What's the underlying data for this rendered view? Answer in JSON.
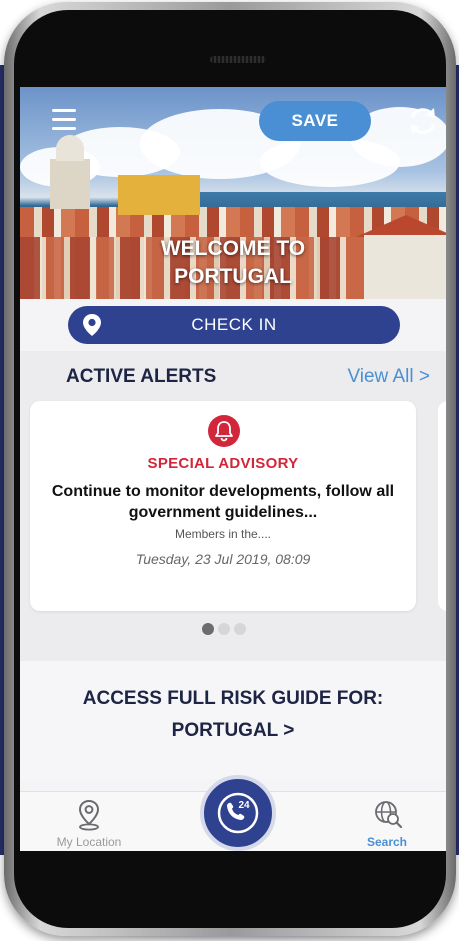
{
  "header": {
    "save_label": "SAVE",
    "welcome_line1": "WELCOME TO",
    "welcome_line2": "PORTUGAL"
  },
  "check_in": {
    "label": "CHECK IN"
  },
  "alerts": {
    "title": "ACTIVE ALERTS",
    "view_all": "View All >",
    "card": {
      "category": "SPECIAL ADVISORY",
      "text": "Continue to monitor developments, follow all government guidelines...",
      "subtext": "Members in the....",
      "date": "Tuesday, 23 Jul 2019, 08:09"
    },
    "pagination": {
      "count": 3,
      "active_index": 0
    }
  },
  "risk_guide": {
    "line1": "ACCESS FULL RISK GUIDE FOR:",
    "line2": "PORTUGAL >"
  },
  "tabbar": {
    "my_location": "My Location",
    "center_icon": "24",
    "search": "Search"
  },
  "colors": {
    "brand_navy": "#2f4290",
    "accent_blue": "#4a8fd4",
    "alert_red": "#d2263a",
    "backdrop_navy": "#27306e"
  }
}
